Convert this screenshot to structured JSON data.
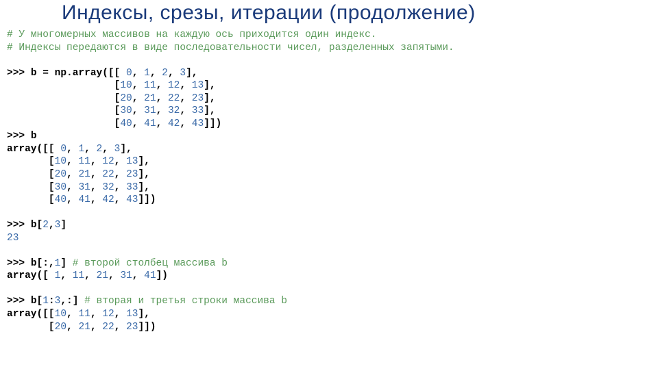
{
  "title": "Индексы, срезы, итерации (продолжение)",
  "comments": {
    "c1": "# У многомерных массивов на каждую ось приходится один индекс.",
    "c2": "# Индексы передаются в виде последовательности чисел, разделенных запятыми."
  },
  "block1": {
    "prompt": ">>> ",
    "assign": "b = np.array([[ ",
    "r1": {
      "a": "0",
      "b": "1",
      "c": "2",
      "d": "3"
    },
    "r2": {
      "a": "10",
      "b": "11",
      "c": "12",
      "d": "13"
    },
    "r3": {
      "a": "20",
      "b": "21",
      "c": "22",
      "d": "23"
    },
    "r4": {
      "a": "30",
      "b": "31",
      "c": "32",
      "d": "33"
    },
    "r5": {
      "a": "40",
      "b": "41",
      "c": "42",
      "d": "43"
    }
  },
  "block2": {
    "prompt": ">>> ",
    "var": "b",
    "head": "array([[ ",
    "r1": {
      "a": "0",
      "b": "1",
      "c": "2",
      "d": "3"
    },
    "r2": {
      "a": "10",
      "b": "11",
      "c": "12",
      "d": "13"
    },
    "r3": {
      "a": "20",
      "b": "21",
      "c": "22",
      "d": "23"
    },
    "r4": {
      "a": "30",
      "b": "31",
      "c": "32",
      "d": "33"
    },
    "r5": {
      "a": "40",
      "b": "41",
      "c": "42",
      "d": "43"
    }
  },
  "block3": {
    "prompt": ">>> ",
    "expr_pre": "b[",
    "i": "2",
    "j": "3",
    "result": "23"
  },
  "block4": {
    "prompt": ">>> ",
    "expr": "b[:,",
    "col": "1",
    "comment": "# второй столбец массива b",
    "out_head": "array([ ",
    "v1": "1",
    "v2": "11",
    "v3": "21",
    "v4": "31",
    "v5": "41"
  },
  "block5": {
    "prompt": ">>> ",
    "expr_a": "b[",
    "s1": "1",
    "s2": "3",
    "rest": ",:]",
    "comment": "# вторая и третья строки массива b",
    "out_head": "array([[",
    "r1": {
      "a": "10",
      "b": "11",
      "c": "12",
      "d": "13"
    },
    "r2": {
      "a": "20",
      "b": "21",
      "c": "22",
      "d": "23"
    }
  }
}
